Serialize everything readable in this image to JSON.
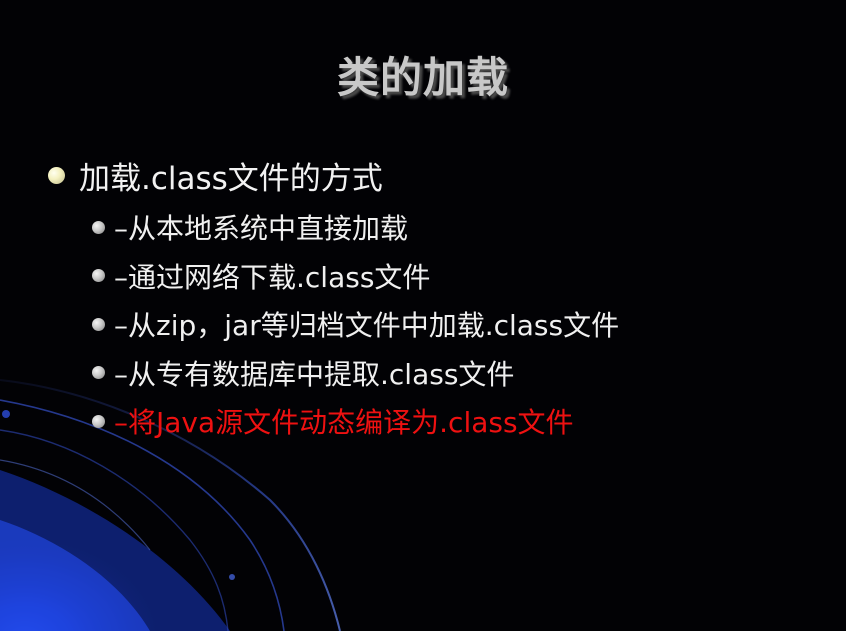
{
  "slide": {
    "title": "类的加载",
    "main_bullet": {
      "text": "加载.class文件的方式",
      "bullet_icon": "round-bullet-cream-icon"
    },
    "sub_bullets": [
      {
        "text": "–从本地系统中直接加载",
        "color": "#f0f0f0"
      },
      {
        "text": "–通过网络下载.class文件",
        "color": "#f0f0f0"
      },
      {
        "text": "–从zip，jar等归档文件中加载.class文件",
        "color": "#f0f0f0"
      },
      {
        "text": "–从专有数据库中提取.class文件",
        "color": "#f0f0f0"
      },
      {
        "text": "–将Java源文件动态编译为.class文件",
        "color": "#ee1111"
      }
    ],
    "colors": {
      "background": "#020205",
      "title": "#c8c8c8",
      "body_text": "#f0f0f0",
      "highlight": "#ee1111",
      "accent_blue": "#1a3fc8"
    }
  }
}
